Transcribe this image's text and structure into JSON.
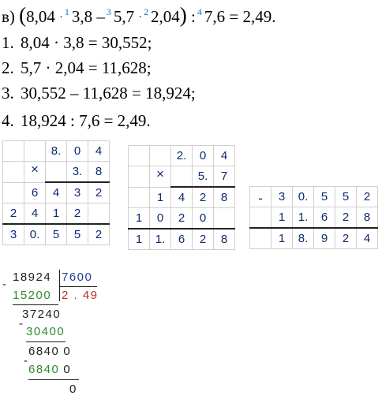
{
  "expression": {
    "label": "в)",
    "open_paren": "(",
    "n1": "8,04",
    "mul1": "·",
    "step1": "1",
    "n2": "3,8",
    "minus": "–",
    "step3": "3",
    "n3": "5,7",
    "mul2": "·",
    "step2": "2",
    "n4": "2,04",
    "close_paren": ")",
    "div_sign": ":",
    "step4": "4",
    "n5": "7,6",
    "eq": "=",
    "result": "2,49."
  },
  "steps": [
    {
      "num": "1.",
      "text": "8,04 · 3,8 = 30,552;"
    },
    {
      "num": "2.",
      "text": "5,7 · 2,04 = 11,628;"
    },
    {
      "num": "3.",
      "text": "30,552 – 11,628 = 18,924;"
    },
    {
      "num": "4.",
      "text": "18,924 : 7,6 = 2,49."
    }
  ],
  "mult1": {
    "op": "×",
    "rows": [
      [
        "",
        "",
        "8.",
        "0",
        "4"
      ],
      [
        "",
        "",
        "",
        "3.",
        "8"
      ],
      [
        "",
        "6",
        "4",
        "3",
        "2"
      ],
      [
        "2",
        "4",
        "1",
        "2",
        ""
      ],
      [
        "3",
        "0.",
        "5",
        "5",
        "2"
      ]
    ]
  },
  "mult2": {
    "op": "×",
    "rows": [
      [
        "",
        "",
        "2.",
        "0",
        "4"
      ],
      [
        "",
        "",
        "",
        "5.",
        "7"
      ],
      [
        "",
        "1",
        "4",
        "2",
        "8"
      ],
      [
        "1",
        "0",
        "2",
        "0",
        ""
      ],
      [
        "1",
        "1.",
        "6",
        "2",
        "8"
      ]
    ]
  },
  "subtraction": {
    "op": "-",
    "rows": [
      [
        "3",
        "0.",
        "5",
        "5",
        "2"
      ],
      [
        "1",
        "1.",
        "6",
        "2",
        "8"
      ],
      [
        "1",
        "8.",
        "9",
        "2",
        "4"
      ]
    ]
  },
  "long_division": {
    "minus": "-",
    "dividend": "18924",
    "divisor": "7600",
    "quotient": "2 . 49",
    "sub1": "15200",
    "rem1": "37240",
    "sub2": "30400",
    "rem2_main": "6840",
    "rem2_tail": "0",
    "sub3_main": "6840",
    "sub3_tail": "0",
    "final_rem": "0"
  }
}
